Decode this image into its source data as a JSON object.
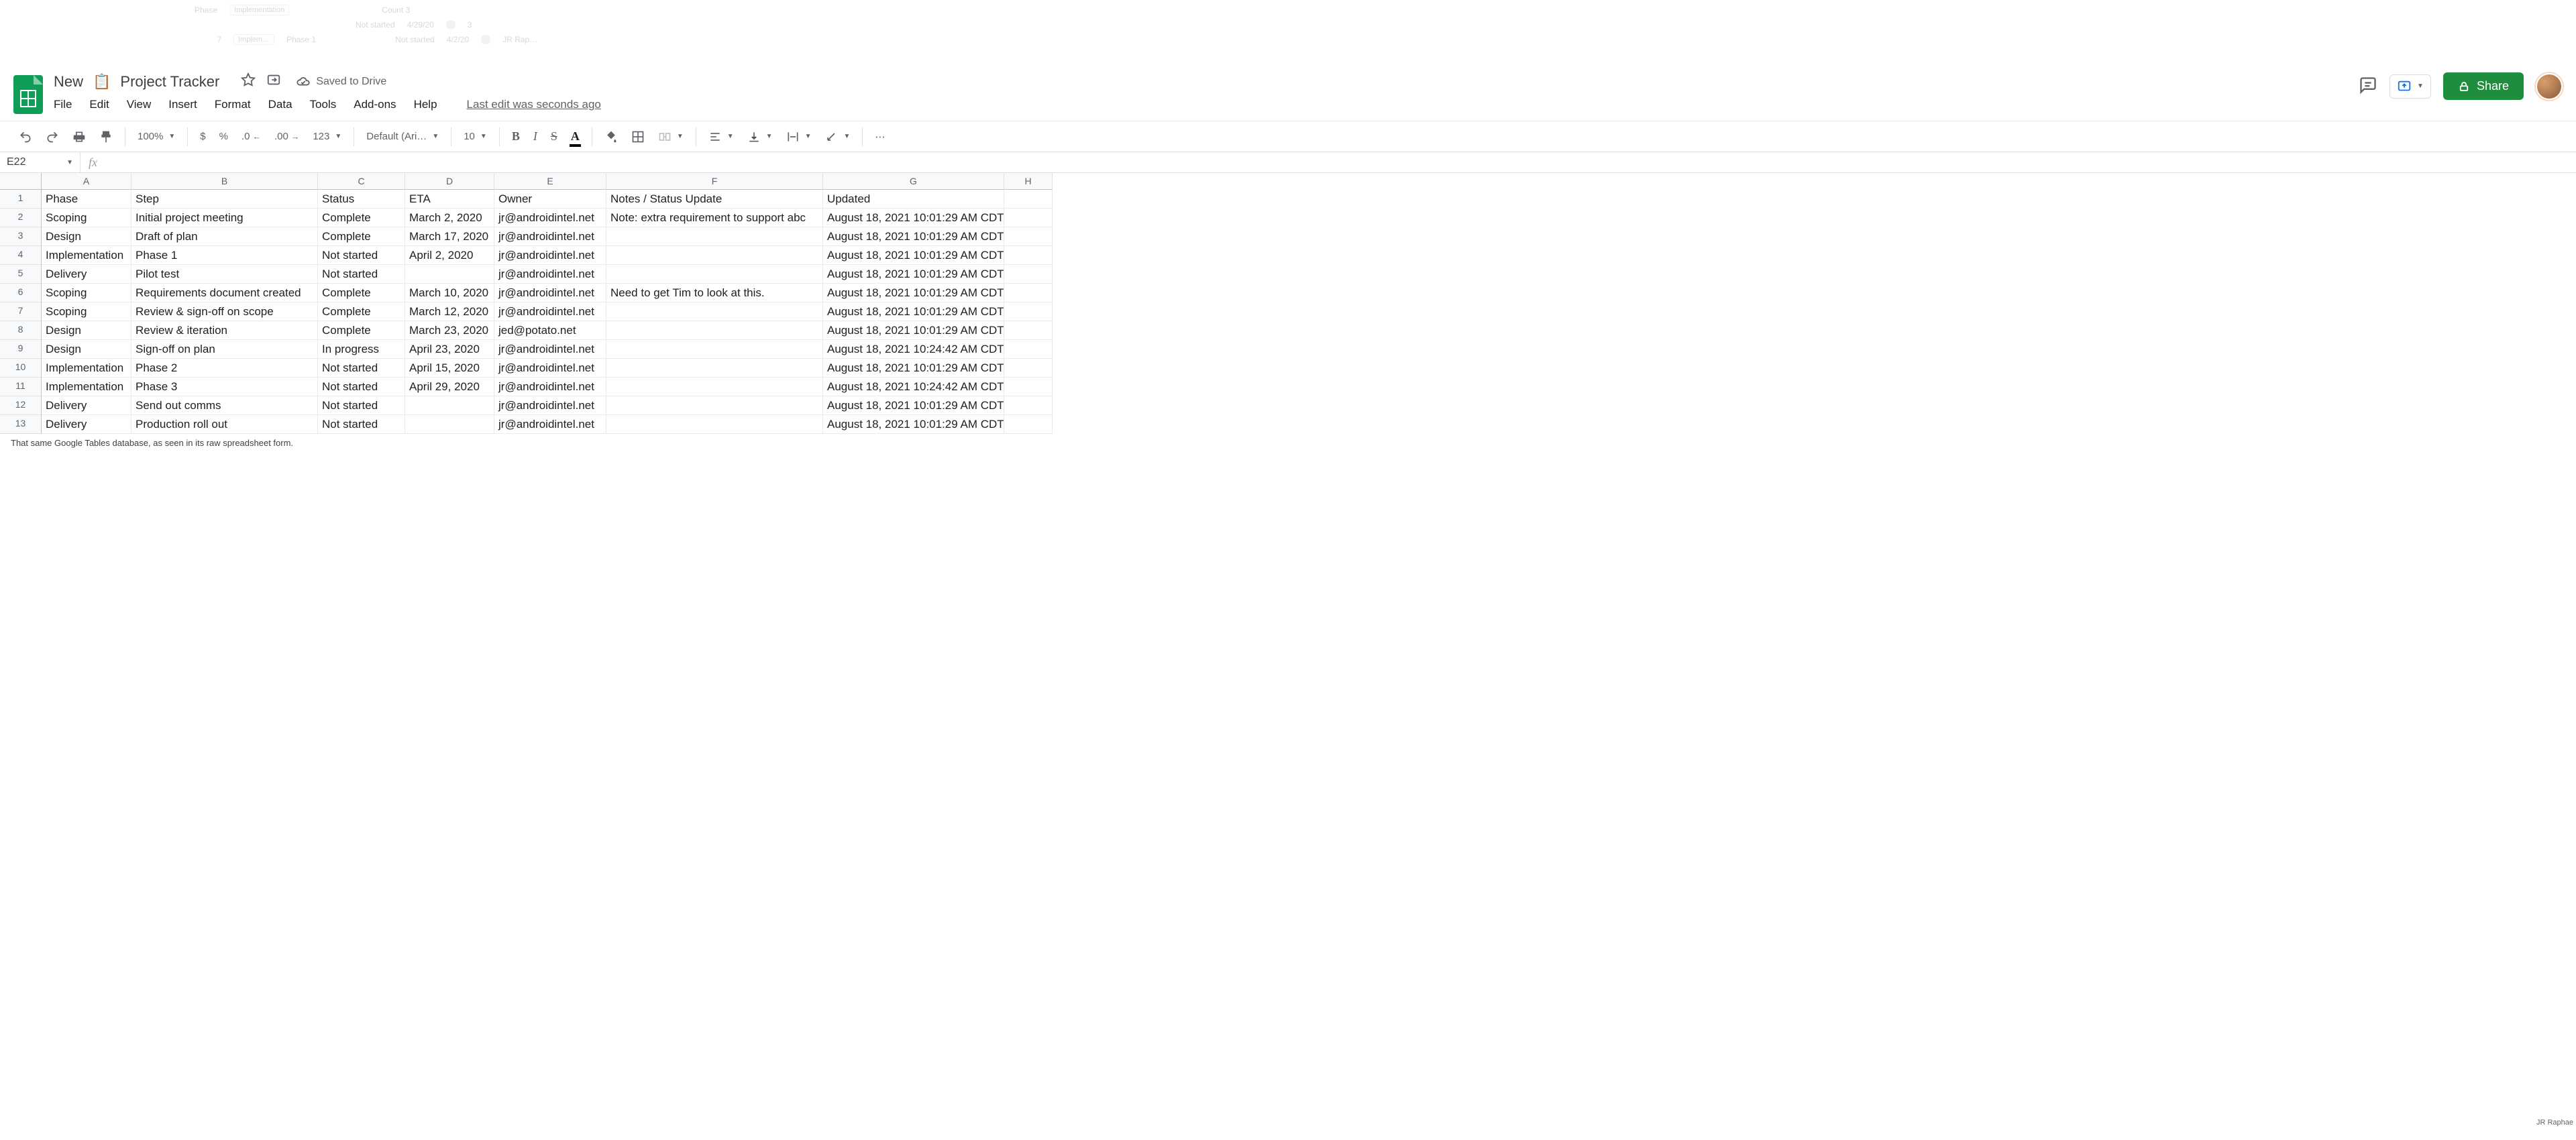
{
  "faded": {
    "phase_label": "Phase",
    "phase_chip": "Implementation",
    "count_label": "Count 3",
    "status": "Not started",
    "date1": "4/29/20",
    "badge1": "3",
    "rownum": "7",
    "step_chip": "Implem…",
    "step_label": "Phase 1",
    "date2": "4/2/20",
    "owner_short": "JR Rap…"
  },
  "doc": {
    "title_prefix": "New",
    "title_suffix": "Project Tracker",
    "saved": "Saved to Drive",
    "last_edit": "Last edit was seconds ago",
    "share": "Share"
  },
  "menu": [
    "File",
    "Edit",
    "View",
    "Insert",
    "Format",
    "Data",
    "Tools",
    "Add-ons",
    "Help"
  ],
  "toolbar": {
    "zoom": "100%",
    "currency": "$",
    "percent": "%",
    "dec_dec": ".0",
    "dec_inc": ".00",
    "numfmt": "123",
    "font": "Default (Ari…",
    "fontsize": "10",
    "bold": "B",
    "italic": "I",
    "strike": "S",
    "textcolor": "A",
    "more": "⋯"
  },
  "namebox": "E22",
  "fx": "fx",
  "columns": [
    "A",
    "B",
    "C",
    "D",
    "E",
    "F",
    "G",
    "H"
  ],
  "headers": [
    "Phase",
    "Step",
    "Status",
    "ETA",
    "Owner",
    "Notes / Status Update",
    "Updated",
    ""
  ],
  "rows": [
    [
      "Scoping",
      "Initial project meeting",
      "Complete",
      "March 2, 2020",
      "jr@androidintel.net",
      "Note: extra requirement to support abc",
      "August 18, 2021 10:01:29 AM CDT",
      ""
    ],
    [
      "Design",
      "Draft of plan",
      "Complete",
      "March 17, 2020",
      "jr@androidintel.net",
      "",
      "August 18, 2021 10:01:29 AM CDT",
      ""
    ],
    [
      "Implementation",
      "Phase 1",
      "Not started",
      "April 2, 2020",
      "jr@androidintel.net",
      "",
      "August 18, 2021 10:01:29 AM CDT",
      ""
    ],
    [
      "Delivery",
      "Pilot test",
      "Not started",
      "",
      "jr@androidintel.net",
      "",
      "August 18, 2021 10:01:29 AM CDT",
      ""
    ],
    [
      "Scoping",
      "Requirements document created",
      "Complete",
      "March 10, 2020",
      "jr@androidintel.net",
      "Need to get Tim to look at this.",
      "August 18, 2021 10:01:29 AM CDT",
      ""
    ],
    [
      "Scoping",
      "Review & sign-off on scope",
      "Complete",
      "March 12, 2020",
      "jr@androidintel.net",
      "",
      "August 18, 2021 10:01:29 AM CDT",
      ""
    ],
    [
      "Design",
      "Review & iteration",
      "Complete",
      "March 23, 2020",
      "jed@potato.net",
      "",
      "August 18, 2021 10:01:29 AM CDT",
      ""
    ],
    [
      "Design",
      "Sign-off on plan",
      "In progress",
      "April 23, 2020",
      "jr@androidintel.net",
      "",
      "August 18, 2021 10:24:42 AM CDT",
      ""
    ],
    [
      "Implementation",
      "Phase 2",
      "Not started",
      "April 15, 2020",
      "jr@androidintel.net",
      "",
      "August 18, 2021 10:01:29 AM CDT",
      ""
    ],
    [
      "Implementation",
      "Phase 3",
      "Not started",
      "April 29, 2020",
      "jr@androidintel.net",
      "",
      "August 18, 2021 10:24:42 AM CDT",
      ""
    ],
    [
      "Delivery",
      "Send out comms",
      "Not started",
      "",
      "jr@androidintel.net",
      "",
      "August 18, 2021 10:01:29 AM CDT",
      ""
    ],
    [
      "Delivery",
      "Production roll out",
      "Not started",
      "",
      "jr@androidintel.net",
      "",
      "August 18, 2021 10:01:29 AM CDT",
      ""
    ]
  ],
  "caption": "That same Google Tables database, as seen in its raw spreadsheet form.",
  "credit": "JR Raphae"
}
